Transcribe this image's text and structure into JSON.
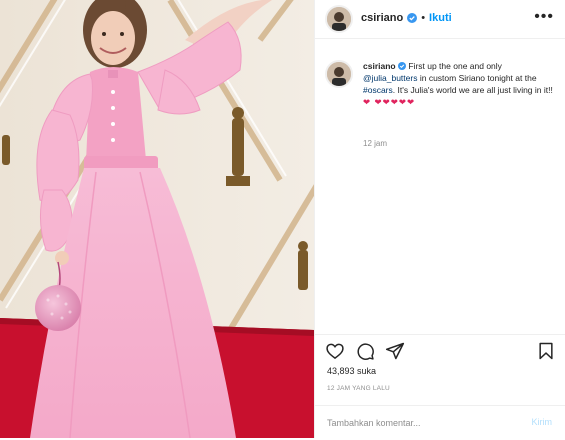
{
  "post": {
    "username": "csiriano",
    "follow_label": "Ikuti",
    "separator": "•",
    "more_label": "•••",
    "caption_username": "csiriano",
    "caption_before_mention": "First up the one and only",
    "mention": "@julia_butters",
    "caption_middle": "in custom Siriano tonight at the",
    "hashtag": "#oscars",
    "caption_after": ". It's Julia's world we are all just living in it!!",
    "hearts": "❤ ❤❤❤❤❤",
    "comment_time": "12 jam",
    "likes": "43,893 suka",
    "date": "12 JAM YANG LALU",
    "comment_placeholder": "Tambahkan komentar...",
    "post_button": "Kirim"
  },
  "colors": {
    "accent": "#0095f6",
    "post_disabled": "#b2dffc",
    "heart": "#e0245e",
    "dress": "#f4a6c8",
    "carpet": "#c8102e"
  },
  "icons": {
    "like": "heart-outline-icon",
    "comment": "comment-bubble-icon",
    "share": "paper-plane-icon",
    "save": "bookmark-icon",
    "verified": "verified-badge-icon",
    "more": "more-options-icon"
  }
}
